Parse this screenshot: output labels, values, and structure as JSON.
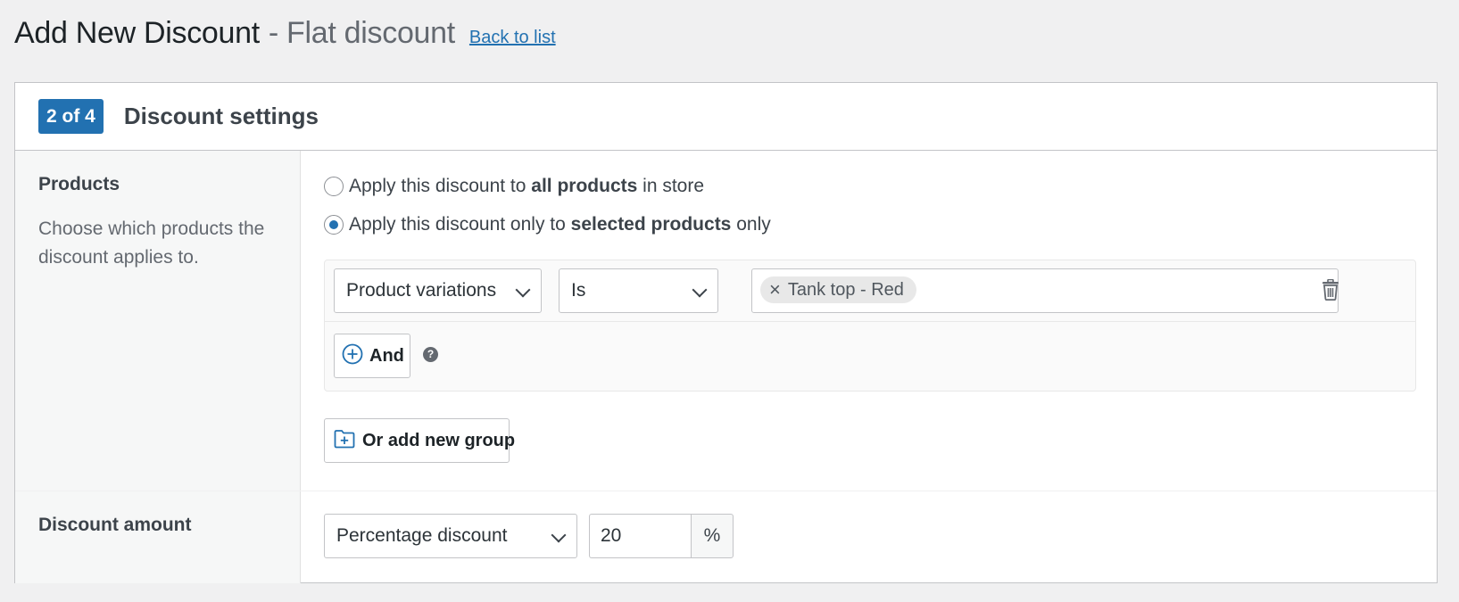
{
  "header": {
    "title": "Add New Discount",
    "subtitle": "- Flat discount",
    "back_link": "Back to list"
  },
  "card": {
    "step_badge": "2 of 4",
    "title": "Discount settings"
  },
  "products": {
    "label": "Products",
    "description": "Choose which products the discount applies to.",
    "options": [
      {
        "prefix": "Apply this discount to ",
        "bold": "all products",
        "suffix": " in store",
        "selected": false
      },
      {
        "prefix": "Apply this discount only to ",
        "bold": "selected products",
        "suffix": " only",
        "selected": true
      }
    ],
    "condition": {
      "field": "Product variations",
      "operator": "Is",
      "tags": [
        "Tank top - Red"
      ],
      "tag_remove": "×"
    },
    "and_button": "And",
    "help_icon": "?",
    "or_group_button": "Or add new group"
  },
  "amount": {
    "label": "Discount amount",
    "type": "Percentage discount",
    "value": "20",
    "suffix": "%"
  },
  "colors": {
    "accent": "#2271b1",
    "background": "#f0f0f1",
    "panel": "#f6f7f7"
  }
}
